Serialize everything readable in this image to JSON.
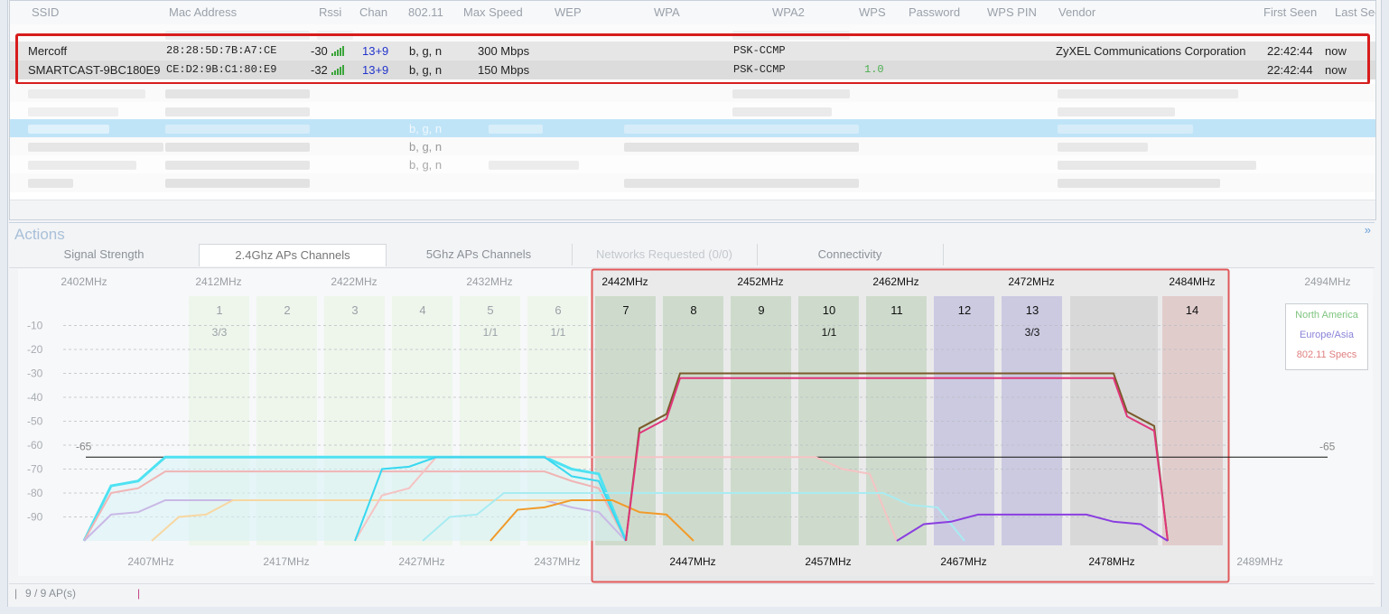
{
  "table": {
    "columns": [
      "SSID",
      "Mac Address",
      "Rssi",
      "Chan",
      "802.11",
      "Max Speed",
      "WEP",
      "WPA",
      "WPA2",
      "WPS",
      "Password",
      "WPS PIN",
      "Vendor",
      "First Seen",
      "Last Seen"
    ],
    "rows": [
      {
        "ssid": "Mercoff",
        "mac": "28:28:5D:7B:A7:CE",
        "rssi": "-30",
        "chan": "13+9",
        "mode": "b, g, n",
        "speed": "300 Mbps",
        "wpa2": "PSK-CCMP",
        "wps": "",
        "vendor": "ZyXEL Communications Corporation",
        "first": "22:42:44",
        "last": "now"
      },
      {
        "ssid": "SMARTCAST-9BC180E9",
        "mac": "CE:D2:9B:C1:80:E9",
        "rssi": "-32",
        "chan": "13+9",
        "mode": "b, g, n",
        "speed": "150 Mbps",
        "wpa2": "PSK-CCMP",
        "wps": "1.0",
        "vendor": "",
        "first": "22:42:44",
        "last": "now"
      }
    ],
    "blurred_modes": [
      "b, g, n",
      "b, g, n",
      "b, g, n"
    ]
  },
  "actions": {
    "label": "Actions",
    "collapse_icon": "chevron-double-down-icon"
  },
  "tabs": [
    {
      "label": "Signal Strength",
      "state": "normal"
    },
    {
      "label": "2.4Ghz APs Channels",
      "state": "active"
    },
    {
      "label": "5Ghz APs Channels",
      "state": "normal"
    },
    {
      "label": "Networks Requested (0/0)",
      "state": "disabled"
    },
    {
      "label": "Connectivity",
      "state": "normal"
    }
  ],
  "status": {
    "text": "9 / 9 AP(s)"
  },
  "chart_data": {
    "type": "channel-spectrum",
    "top_freqs": [
      "2402MHz",
      "2412MHz",
      "2422MHz",
      "2432MHz",
      "2442MHz",
      "2452MHz",
      "2462MHz",
      "2472MHz",
      "2484MHz",
      "2494MHz"
    ],
    "bottom_freqs": [
      "2407MHz",
      "2417MHz",
      "2427MHz",
      "2437MHz",
      "2447MHz",
      "2457MHz",
      "2467MHz",
      "2478MHz",
      "2489MHz"
    ],
    "channels": [
      {
        "n": "1",
        "count": "3/3"
      },
      {
        "n": "2",
        "count": ""
      },
      {
        "n": "3",
        "count": ""
      },
      {
        "n": "4",
        "count": ""
      },
      {
        "n": "5",
        "count": "1/1"
      },
      {
        "n": "6",
        "count": "1/1"
      },
      {
        "n": "7",
        "count": ""
      },
      {
        "n": "8",
        "count": ""
      },
      {
        "n": "9",
        "count": ""
      },
      {
        "n": "10",
        "count": "1/1"
      },
      {
        "n": "11",
        "count": ""
      },
      {
        "n": "12",
        "count": ""
      },
      {
        "n": "13",
        "count": "3/3"
      },
      {
        "n": "14",
        "count": ""
      }
    ],
    "y_ticks": [
      "-10",
      "-20",
      "-30",
      "-40",
      "-50",
      "-60",
      "-70",
      "-80",
      "-90"
    ],
    "threshold": {
      "value": -65,
      "label": "-65"
    },
    "legend": [
      {
        "label": "North America",
        "color": "#7fc47f"
      },
      {
        "label": "Europe/Asia",
        "color": "#8a84d8"
      },
      {
        "label": "802.11 Specs",
        "color": "#e07f7f"
      }
    ],
    "series": [
      {
        "color": "#4ee2f2",
        "values": [
          [
            "2402",
            -100
          ],
          [
            "2404",
            -77
          ],
          [
            "2406",
            -75
          ],
          [
            "2408",
            -65
          ],
          [
            "2436",
            -65
          ],
          [
            "2438",
            -70
          ],
          [
            "2440",
            -72
          ],
          [
            "2442",
            -100
          ]
        ]
      },
      {
        "color": "#f0b4b4",
        "values": [
          [
            "2402",
            -100
          ],
          [
            "2404",
            -80
          ],
          [
            "2406",
            -78
          ],
          [
            "2408",
            -71
          ],
          [
            "2436",
            -71
          ],
          [
            "2438",
            -75
          ],
          [
            "2440",
            -78
          ],
          [
            "2442",
            -100
          ]
        ]
      },
      {
        "color": "#c9b8e6",
        "values": [
          [
            "2402",
            -100
          ],
          [
            "2404",
            -89
          ],
          [
            "2406",
            -88
          ],
          [
            "2408",
            -83
          ],
          [
            "2436",
            -83
          ],
          [
            "2438",
            -86
          ],
          [
            "2440",
            -88
          ],
          [
            "2442",
            -100
          ]
        ]
      },
      {
        "color": "#f7d7a2",
        "values": [
          [
            "2407",
            -100
          ],
          [
            "2409",
            -90
          ],
          [
            "2411",
            -89
          ],
          [
            "2413",
            -83
          ],
          [
            "2441",
            -83
          ],
          [
            "2443",
            -88
          ],
          [
            "2445",
            -89
          ],
          [
            "2447",
            -100
          ]
        ]
      },
      {
        "color": "#f5c3c3",
        "values": [
          [
            "2422",
            -100
          ],
          [
            "2424",
            -81
          ],
          [
            "2426",
            -78
          ],
          [
            "2428",
            -65
          ],
          [
            "2456",
            -65
          ],
          [
            "2458",
            -70
          ],
          [
            "2460",
            -72
          ],
          [
            "2462",
            -100
          ]
        ]
      },
      {
        "color": "#a8ecf2",
        "values": [
          [
            "2427",
            -100
          ],
          [
            "2429",
            -90
          ],
          [
            "2431",
            -89
          ],
          [
            "2433",
            -80
          ],
          [
            "2461",
            -80
          ],
          [
            "2463",
            -85
          ],
          [
            "2465",
            -86
          ],
          [
            "2467",
            -100
          ]
        ]
      },
      {
        "color": "#38d8f0",
        "values": [
          [
            "2422",
            -100
          ],
          [
            "2424",
            -70
          ],
          [
            "2426",
            -69
          ],
          [
            "2428",
            -65
          ],
          [
            "2436",
            -65
          ],
          [
            "2438",
            -73
          ],
          [
            "2440",
            -75
          ],
          [
            "2442",
            -100
          ]
        ]
      },
      {
        "color": "#f09a2a",
        "values": [
          [
            "2432",
            -100
          ],
          [
            "2434",
            -87
          ],
          [
            "2436",
            -86
          ],
          [
            "2438",
            -83
          ],
          [
            "2441",
            -83
          ],
          [
            "2443",
            -88
          ],
          [
            "2445",
            -89
          ],
          [
            "2447",
            -100
          ]
        ]
      },
      {
        "color": "#7a5a2a",
        "values": [
          [
            "2442",
            -100
          ],
          [
            "2443",
            -53
          ],
          [
            "2445",
            -47
          ],
          [
            "2446",
            -30
          ],
          [
            "2478",
            -30
          ],
          [
            "2479",
            -46
          ],
          [
            "2481",
            -52
          ],
          [
            "2482",
            -100
          ]
        ]
      },
      {
        "color": "#e0357a",
        "values": [
          [
            "2442",
            -100
          ],
          [
            "2443",
            -55
          ],
          [
            "2445",
            -49
          ],
          [
            "2446",
            -32
          ],
          [
            "2478",
            -32
          ],
          [
            "2479",
            -48
          ],
          [
            "2481",
            -54
          ],
          [
            "2482",
            -100
          ]
        ]
      },
      {
        "color": "#8a3ee0",
        "values": [
          [
            "2462",
            -100
          ],
          [
            "2464",
            -93
          ],
          [
            "2466",
            -92
          ],
          [
            "2468",
            -89
          ],
          [
            "2476",
            -89
          ],
          [
            "2478",
            -92
          ],
          [
            "2480",
            -93
          ],
          [
            "2482",
            -100
          ]
        ]
      }
    ]
  }
}
